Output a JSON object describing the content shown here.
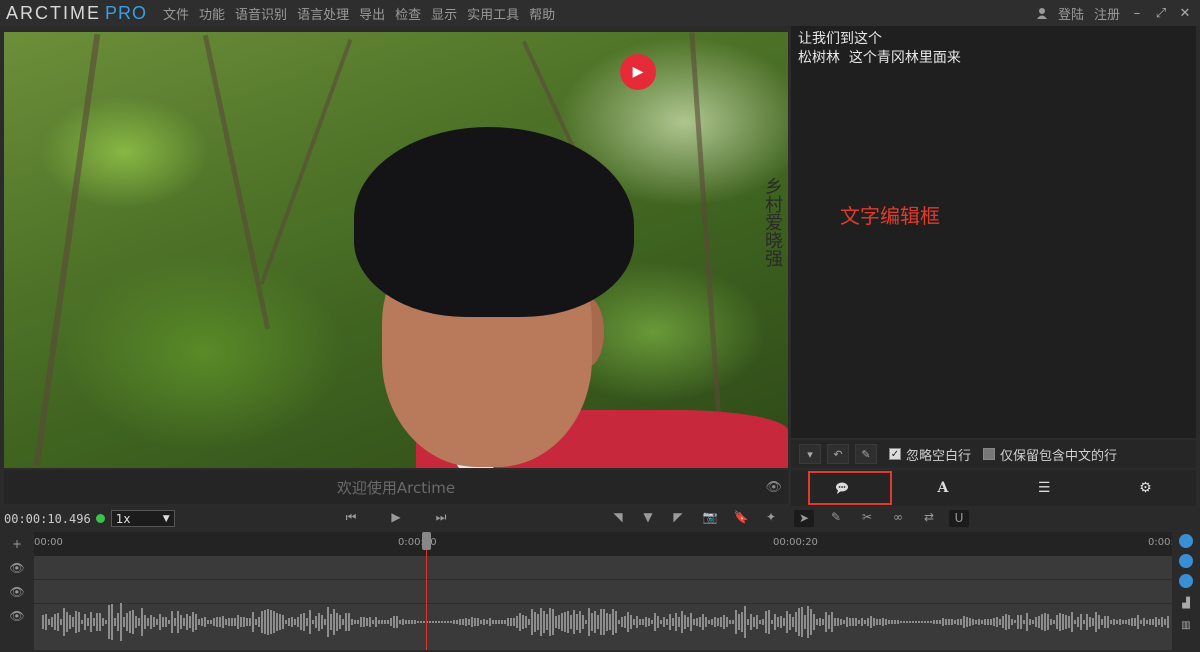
{
  "app": {
    "logo_main": "ARCTIME",
    "logo_pro": "PRO"
  },
  "menu": [
    "文件",
    "功能",
    "语音识别",
    "语言处理",
    "导出",
    "检查",
    "显示",
    "实用工具",
    "帮助"
  ],
  "account": {
    "login": "登陆",
    "register": "注册"
  },
  "window_controls": [
    "–",
    "⤢",
    "✕"
  ],
  "video": {
    "welcome_text": "欢迎使用Arctime",
    "watermark": "乡村爱晓强"
  },
  "editor": {
    "lines": [
      "让我们到这个",
      "松树林  这个青冈林里面来"
    ],
    "annotation": "文字编辑框"
  },
  "editor_toolbar": {
    "ignore_blank_label": "忽略空白行",
    "ignore_blank_checked": true,
    "keep_chinese_label": "仅保留包含中文的行",
    "keep_chinese_checked": false
  },
  "editor_tabs": [
    {
      "icon": "speech-bubble-icon",
      "glyph": "💬",
      "active": true
    },
    {
      "icon": "font-icon",
      "glyph": "A",
      "active": false
    },
    {
      "icon": "list-icon",
      "glyph": "☰",
      "active": false
    },
    {
      "icon": "gear-icon",
      "glyph": "⚙",
      "active": false
    }
  ],
  "transport": {
    "timecode": "00:00:10.496",
    "speed": "1x"
  },
  "timeline": {
    "ruler_labels": [
      "00:00",
      "0:00:10",
      "00:00:20",
      "0:00:"
    ]
  },
  "colors": {
    "accent_blue": "#3a9ee4",
    "playhead_red": "#e0342a",
    "annotation_red": "#e03b2c",
    "status_green": "#3cc24a"
  }
}
